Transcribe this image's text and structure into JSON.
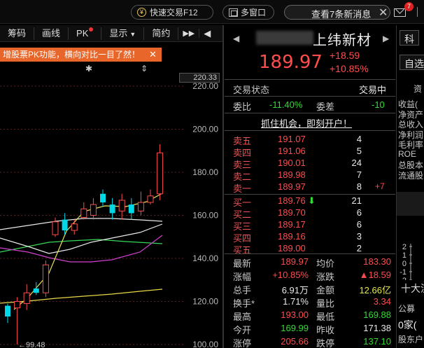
{
  "topbar": {
    "trade_label": "快速交易F12",
    "window_label": "多窗口",
    "news_label": "查看7条新消息",
    "news_close": "✕",
    "mail_badge": "7"
  },
  "toolbar": {
    "items": [
      "筹码",
      "画线",
      "PK",
      "显示",
      "简约"
    ],
    "arrows": "▶▶",
    "chevron": "◀"
  },
  "pk_banner": {
    "text": "增股票PK功能，横向对比一目了然！",
    "close": "✕"
  },
  "chart_data": {
    "type": "candlestick",
    "price_axis_labels": [
      "220.00",
      "200.00",
      "180.00",
      "160.00",
      "140.00",
      "120.00",
      "100.00"
    ],
    "current_price_tag": "220.33",
    "low_marker": "99.48",
    "ylim": [
      100,
      220
    ],
    "candles": [
      {
        "o": 118,
        "c": 113,
        "h": 119,
        "l": 110,
        "color": "cyan"
      },
      {
        "o": 117,
        "c": 120,
        "h": 122,
        "l": 100,
        "color": "red"
      },
      {
        "o": 119,
        "c": 124,
        "h": 128,
        "l": 116,
        "color": "red"
      },
      {
        "o": 124,
        "c": 126,
        "h": 129,
        "l": 123,
        "color": "cyan"
      },
      {
        "o": 124,
        "c": 137,
        "h": 139,
        "l": 122,
        "color": "red"
      },
      {
        "o": 151,
        "c": 157,
        "h": 159,
        "l": 150,
        "color": "red"
      },
      {
        "o": 153,
        "c": 158,
        "h": 161,
        "l": 151,
        "color": "cyan"
      },
      {
        "o": 153,
        "c": 156,
        "h": 158,
        "l": 151,
        "color": "red"
      },
      {
        "o": 159,
        "c": 163,
        "h": 166,
        "l": 158,
        "color": "red"
      },
      {
        "o": 165,
        "c": 160,
        "h": 168,
        "l": 158,
        "color": "red"
      },
      {
        "o": 170,
        "c": 166,
        "h": 172,
        "l": 164,
        "color": "cyan"
      },
      {
        "o": 165,
        "c": 161,
        "h": 168,
        "l": 158,
        "color": "cyan"
      },
      {
        "o": 162,
        "c": 167,
        "h": 170,
        "l": 158,
        "color": "red"
      },
      {
        "o": 165,
        "c": 161,
        "h": 168,
        "l": 158,
        "color": "cyan"
      },
      {
        "o": 162,
        "c": 166,
        "h": 171,
        "l": 160,
        "color": "red"
      },
      {
        "o": 166,
        "c": 169,
        "h": 172,
        "l": 165,
        "color": "red"
      },
      {
        "o": 170,
        "c": 189,
        "h": 193,
        "l": 167,
        "color": "red"
      }
    ]
  },
  "quote": {
    "nav_left": "◀",
    "nav_right": "▶",
    "stock_name": "上纬新材",
    "price": "189.97",
    "change_abs": "+18.59",
    "change_pct": "+10.85%",
    "status_label": "交易状态",
    "status_value": "交易中",
    "weibi_label": "委比",
    "weibi_value": "-11.40%",
    "weicha_label": "委差",
    "weicha_value": "-10",
    "promo": "抓住机会，即刻开户！",
    "asks": [
      {
        "label": "卖五",
        "price": "191.07",
        "vol": "4",
        "chg": ""
      },
      {
        "label": "卖四",
        "price": "191.06",
        "vol": "5",
        "chg": ""
      },
      {
        "label": "卖三",
        "price": "190.01",
        "vol": "24",
        "chg": ""
      },
      {
        "label": "卖二",
        "price": "189.98",
        "vol": "7",
        "chg": ""
      },
      {
        "label": "卖一",
        "price": "189.97",
        "vol": "8",
        "chg": "+7"
      }
    ],
    "bids": [
      {
        "label": "买一",
        "price": "189.76",
        "vol": "21",
        "arrow": "⬇"
      },
      {
        "label": "买二",
        "price": "189.70",
        "vol": "6"
      },
      {
        "label": "买三",
        "price": "189.17",
        "vol": "6"
      },
      {
        "label": "买四",
        "price": "189.16",
        "vol": "3"
      },
      {
        "label": "买五",
        "price": "189.00",
        "vol": "2"
      }
    ],
    "details": [
      {
        "l1": "最新",
        "v1": "189.97",
        "c1": "red",
        "l2": "均价",
        "v2": "183.30",
        "c2": "red"
      },
      {
        "l1": "涨幅",
        "v1": "+10.85%",
        "c1": "red",
        "l2": "涨跌",
        "v2": "▲18.59",
        "c2": "red"
      },
      {
        "l1": "总手",
        "v1": "6.91万",
        "c1": "white",
        "l2": "金额",
        "v2": "12.66亿",
        "c2": "yellow"
      },
      {
        "l1": "换手*",
        "v1": "1.71%",
        "c1": "white",
        "l2": "量比",
        "v2": "3.34",
        "c2": "red"
      },
      {
        "l1": "最高",
        "v1": "193.00",
        "c1": "red",
        "l2": "最低",
        "v2": "169.88",
        "c2": "green"
      },
      {
        "l1": "今开",
        "v1": "169.99",
        "c1": "green",
        "l2": "昨收",
        "v2": "171.38",
        "c2": "white"
      },
      {
        "l1": "涨停",
        "v1": "205.66",
        "c1": "red",
        "l2": "跌停",
        "v2": "137.10",
        "c2": "green"
      }
    ]
  },
  "right_panel": {
    "tab_top": "科",
    "select_btn": "自选",
    "info_header": "资",
    "info_items": [
      "收益(",
      "净资产",
      "总收入",
      "净利润",
      "毛利率",
      "ROE",
      "总股本",
      "流通股"
    ],
    "mini_axis": [
      "2",
      "1",
      "0",
      "-1",
      "-2"
    ],
    "bottom_btn": "十大流",
    "ann_label": "公募",
    "ann_count": "0家(",
    "ann_more": "股东户"
  },
  "colors": {
    "up": "#ff4d4d",
    "down": "#2edd2e",
    "candle_down": "#00d8e8",
    "accent_orange": "#e8662a",
    "background": "#000000"
  }
}
